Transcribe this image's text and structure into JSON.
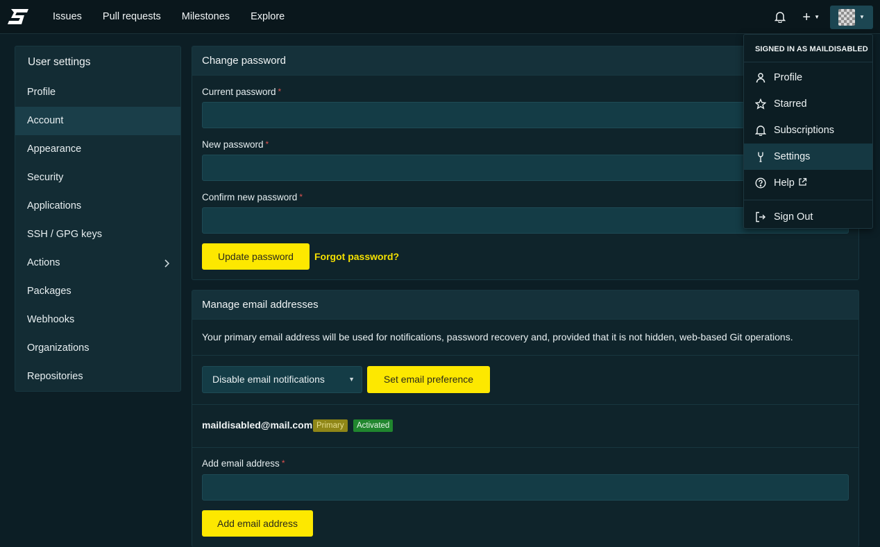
{
  "nav": {
    "links": [
      "Issues",
      "Pull requests",
      "Milestones",
      "Explore"
    ],
    "plus_icon": "plus-icon",
    "bell_icon": "bell-icon"
  },
  "sidebar": {
    "title": "User settings",
    "items": [
      {
        "label": "Profile"
      },
      {
        "label": "Account",
        "active": true
      },
      {
        "label": "Appearance"
      },
      {
        "label": "Security"
      },
      {
        "label": "Applications"
      },
      {
        "label": "SSH / GPG keys"
      },
      {
        "label": "Actions",
        "has_children": true
      },
      {
        "label": "Packages"
      },
      {
        "label": "Webhooks"
      },
      {
        "label": "Organizations"
      },
      {
        "label": "Repositories"
      }
    ]
  },
  "password": {
    "title": "Change password",
    "current_label": "Current password",
    "new_label": "New password",
    "confirm_label": "Confirm new password",
    "required_mark": "*",
    "current_value": "",
    "new_value": "",
    "confirm_value": "",
    "update_button": "Update password",
    "forgot_link": "Forgot password?"
  },
  "email": {
    "title": "Manage email addresses",
    "description": "Your primary email address will be used for notifications, password recovery and, provided that it is not hidden, web-based Git operations.",
    "preference_selected": "Disable email notifications",
    "set_preference_button": "Set email preference",
    "address": "maildisabled@mail.com",
    "badge_primary": "Primary",
    "badge_activated": "Activated",
    "add_label": "Add email address",
    "add_value": "",
    "add_button": "Add email address"
  },
  "menu": {
    "header": "SIGNED IN AS MAILDISABLED",
    "items": [
      {
        "label": "Profile",
        "icon": "person-icon"
      },
      {
        "label": "Starred",
        "icon": "star-icon"
      },
      {
        "label": "Subscriptions",
        "icon": "bell-icon"
      },
      {
        "label": "Settings",
        "icon": "tools-icon",
        "active": true
      },
      {
        "label": "Help",
        "icon": "question-icon"
      },
      {
        "label": "Sign Out",
        "icon": "sign-out-icon"
      }
    ]
  },
  "colors": {
    "accent": "#fde800",
    "background": "#0c1e25",
    "panel": "#0f242b",
    "badge_primary": "#8f8617",
    "badge_activated": "#20862e"
  }
}
